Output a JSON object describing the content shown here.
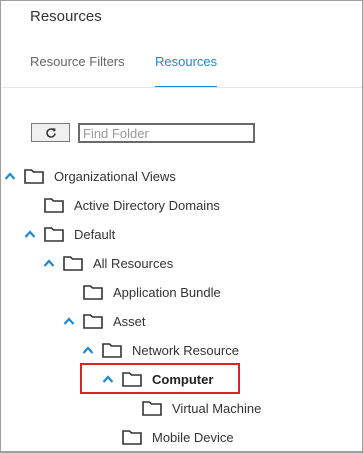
{
  "panel": {
    "title": "Resources"
  },
  "tabs": [
    {
      "label": "Resource Filters",
      "active": false
    },
    {
      "label": "Resources",
      "active": true
    }
  ],
  "toolbar": {
    "refresh_icon": "refresh-icon",
    "search_placeholder": "Find Folder"
  },
  "tree": [
    {
      "label": "Organizational Views",
      "expanded": true
    },
    {
      "label": "Active Directory Domains",
      "expanded": false
    },
    {
      "label": "Default",
      "expanded": true
    },
    {
      "label": "All Resources",
      "expanded": true
    },
    {
      "label": "Application Bundle",
      "expanded": false
    },
    {
      "label": "Asset",
      "expanded": true
    },
    {
      "label": "Network Resource",
      "expanded": true
    },
    {
      "label": "Computer",
      "expanded": true,
      "selected": true
    },
    {
      "label": "Virtual Machine",
      "expanded": false
    },
    {
      "label": "Mobile Device",
      "expanded": false
    }
  ],
  "colors": {
    "accent": "#1e88d8",
    "highlight": "#d9232d",
    "text": "#333333"
  }
}
